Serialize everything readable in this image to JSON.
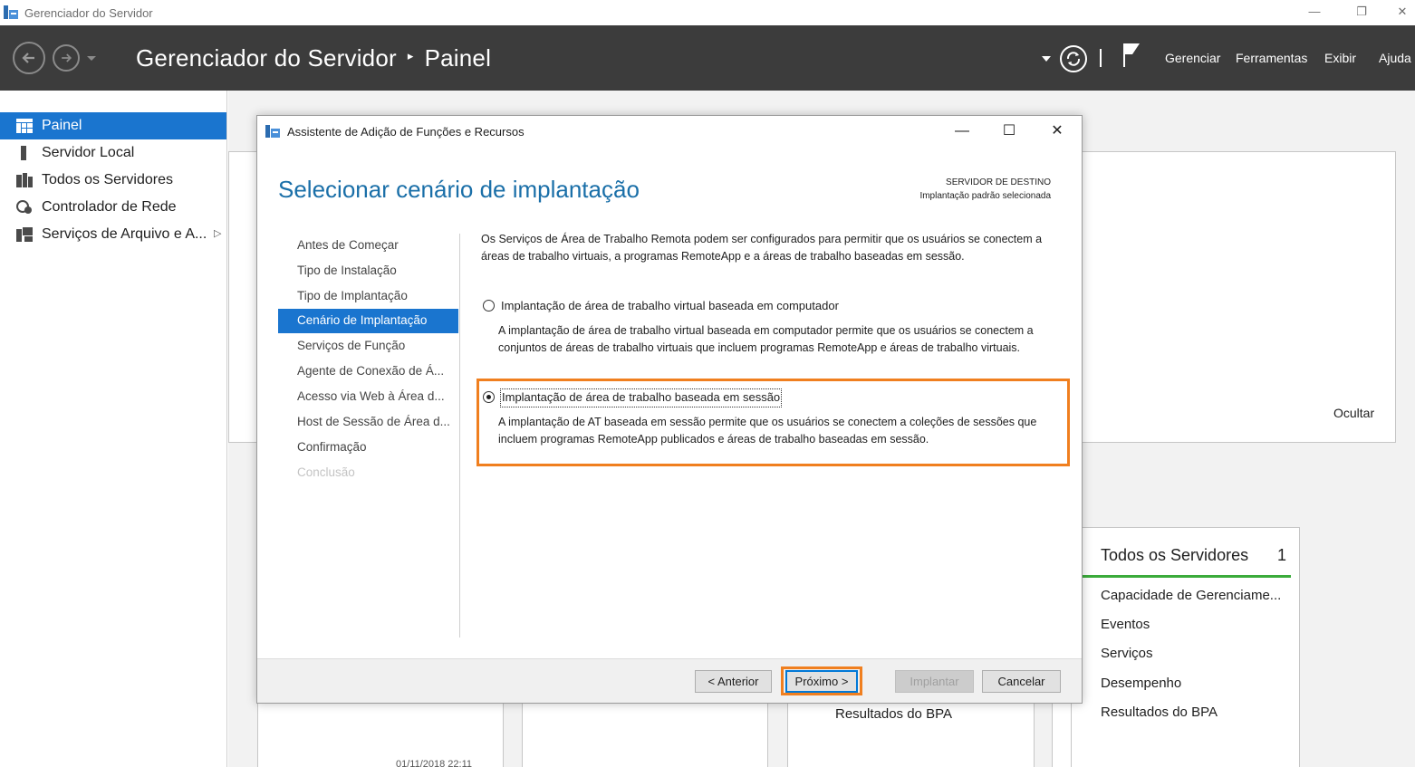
{
  "window": {
    "title": "Gerenciador do Servidor",
    "minimize": "—",
    "restore": "❐",
    "close": "✕"
  },
  "header": {
    "app_name": "Gerenciador do Servidor",
    "separator": "▸",
    "page": "Painel",
    "menu": [
      "Gerenciar",
      "Ferramentas",
      "Exibir",
      "Ajuda"
    ]
  },
  "sidebar": {
    "items": [
      {
        "label": "Painel",
        "icon": "dashboard-icon",
        "active": true
      },
      {
        "label": "Servidor Local",
        "icon": "server-icon",
        "active": false
      },
      {
        "label": "Todos os Servidores",
        "icon": "servers-icon",
        "active": false
      },
      {
        "label": "Controlador de Rede",
        "icon": "network-controller-icon",
        "active": false
      },
      {
        "label": "Serviços de Arquivo e A...",
        "icon": "file-services-icon",
        "active": false,
        "expand": "▷"
      }
    ]
  },
  "background": {
    "hide_link": "Ocultar",
    "all_servers_title": "Todos os Servidores",
    "all_servers_count": "1",
    "tile_links": [
      "Capacidade de Gerenciame...",
      "Eventos",
      "Serviços",
      "Desempenho",
      "Resultados do BPA"
    ],
    "bpa_results_left": "Resultados do BPA",
    "timestamp": "01/11/2018 22:11"
  },
  "dialog": {
    "title": "Assistente de Adição de Funções e Recursos",
    "heading": "Selecionar cenário de implantação",
    "destination_label": "SERVIDOR DE DESTINO",
    "destination_value": "Implantação padrão selecionada",
    "steps": [
      {
        "label": "Antes de Começar",
        "state": "normal"
      },
      {
        "label": "Tipo de Instalação",
        "state": "normal"
      },
      {
        "label": "Tipo de Implantação",
        "state": "normal"
      },
      {
        "label": "Cenário de Implantação",
        "state": "active"
      },
      {
        "label": "Serviços de Função",
        "state": "normal"
      },
      {
        "label": "Agente de Conexão de Á...",
        "state": "normal"
      },
      {
        "label": "Acesso via Web à Área d...",
        "state": "normal"
      },
      {
        "label": "Host de Sessão de Área d...",
        "state": "normal"
      },
      {
        "label": "Confirmação",
        "state": "normal"
      },
      {
        "label": "Conclusão",
        "state": "disabled"
      }
    ],
    "intro": "Os Serviços de Área de Trabalho Remota podem ser configurados para permitir que os usuários se conectem a áreas de trabalho virtuais, a programas RemoteApp e a áreas de trabalho baseadas em sessão.",
    "options": [
      {
        "label": "Implantação de área de trabalho virtual baseada em computador",
        "description": "A implantação de área de trabalho virtual baseada em computador permite que os usuários se conectem a conjuntos de áreas de trabalho virtuais que incluem programas RemoteApp e áreas de trabalho virtuais.",
        "selected": false
      },
      {
        "label": "Implantação de área de trabalho baseada em sessão",
        "description": "A implantação de AT baseada em sessão permite que os usuários se conectem a coleções de sessões que incluem programas RemoteApp publicados e áreas de trabalho baseadas em sessão.",
        "selected": true
      }
    ],
    "buttons": {
      "previous": "< Anterior",
      "next": "Próximo >",
      "deploy": "Implantar",
      "cancel": "Cancelar"
    },
    "minimize": "—",
    "maximize": "☐",
    "close": "✕"
  },
  "colors": {
    "accent": "#1a75cf",
    "header_bg": "#3c3c3c",
    "heading": "#1a6fa8",
    "highlight": "#f07f1f"
  }
}
